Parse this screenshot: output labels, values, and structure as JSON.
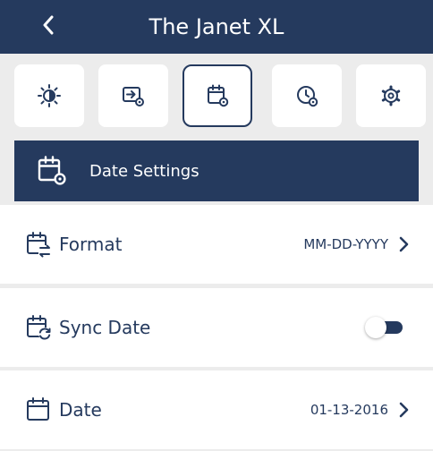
{
  "header": {
    "title": "The Janet XL",
    "back_icon": "chevron-left-icon"
  },
  "tabs": [
    {
      "icon": "brightness-icon",
      "active": false
    },
    {
      "icon": "input-settings-icon",
      "active": false
    },
    {
      "icon": "calendar-settings-icon",
      "active": true
    },
    {
      "icon": "clock-settings-icon",
      "active": false
    },
    {
      "icon": "gear-icon",
      "active": false
    }
  ],
  "section": {
    "title": "Date Settings",
    "icon": "calendar-settings-icon"
  },
  "rows": {
    "format": {
      "label": "Format",
      "value": "MM-DD-YYYY",
      "icon": "calendar-swap-icon"
    },
    "sync_date": {
      "label": "Sync Date",
      "enabled": false,
      "icon": "calendar-sync-icon"
    },
    "date": {
      "label": "Date",
      "value": "01-13-2016",
      "icon": "calendar-icon"
    }
  },
  "colors": {
    "primary": "#253a5e",
    "background": "#ececec",
    "surface": "#ffffff"
  }
}
